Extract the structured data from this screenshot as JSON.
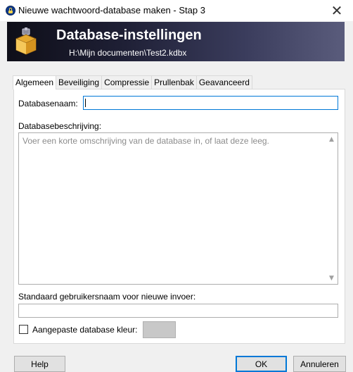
{
  "window": {
    "title": "Nieuwe wachtwoord-database maken - Stap 3",
    "app_icon": "keepass-lock-icon",
    "close_glyph": "✕"
  },
  "banner": {
    "title": "Database-instellingen",
    "subtitle": "H:\\Mijn documenten\\Test2.kdbx",
    "icon": "database-settings-icon"
  },
  "tabs": [
    {
      "label": "Algemeen",
      "active": true
    },
    {
      "label": "Beveiliging",
      "active": false
    },
    {
      "label": "Compressie",
      "active": false
    },
    {
      "label": "Prullenbak",
      "active": false
    },
    {
      "label": "Geavanceerd",
      "active": false
    }
  ],
  "general": {
    "name_label": "Databasenaam:",
    "name_value": "",
    "description_label": "Databasebeschrijving:",
    "description_placeholder": "Voer een korte omschrijving van de database in, of laat deze leeg.",
    "default_user_label": "Standaard gebruikersnaam voor nieuwe invoer:",
    "default_user_value": "",
    "custom_color_label": "Aangepaste database kleur:",
    "custom_color_checked": false,
    "custom_color_swatch": "#c8c8c8"
  },
  "buttons": {
    "help": "Help",
    "ok": "OK",
    "cancel": "Annuleren"
  },
  "colors": {
    "accent": "#0078d7",
    "banner_dark": "#0e0e18",
    "banner_light": "#5a5c7c"
  }
}
